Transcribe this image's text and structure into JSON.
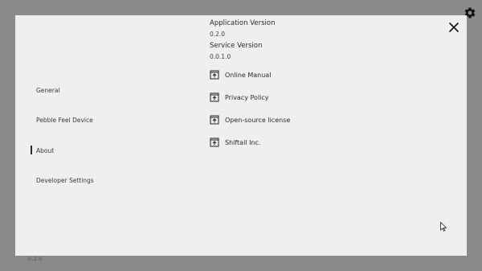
{
  "footer_version": "0.2.0",
  "nav": {
    "items": [
      {
        "label": "General",
        "selected": false
      },
      {
        "label": "Pebble Feel Device",
        "selected": false
      },
      {
        "label": "About",
        "selected": true
      },
      {
        "label": "Developer Settings",
        "selected": false
      }
    ]
  },
  "about": {
    "app_version_label": "Application Version",
    "app_version_value": "0.2.0",
    "service_version_label": "Service Version",
    "service_version_value": "0.0.1.0",
    "links": [
      {
        "label": "Online Manual",
        "icon": "external-link-icon"
      },
      {
        "label": "Privacy Policy",
        "icon": "external-link-icon"
      },
      {
        "label": "Open-source license",
        "icon": "external-link-icon"
      },
      {
        "label": "Shiftall Inc.",
        "icon": "external-link-icon"
      }
    ]
  },
  "icons": {
    "settings": "gear-icon",
    "close": "close-icon"
  },
  "colors": {
    "backdrop": "#8a8a8a",
    "panel": "#efefef",
    "indicator": "#2a2a2a"
  }
}
